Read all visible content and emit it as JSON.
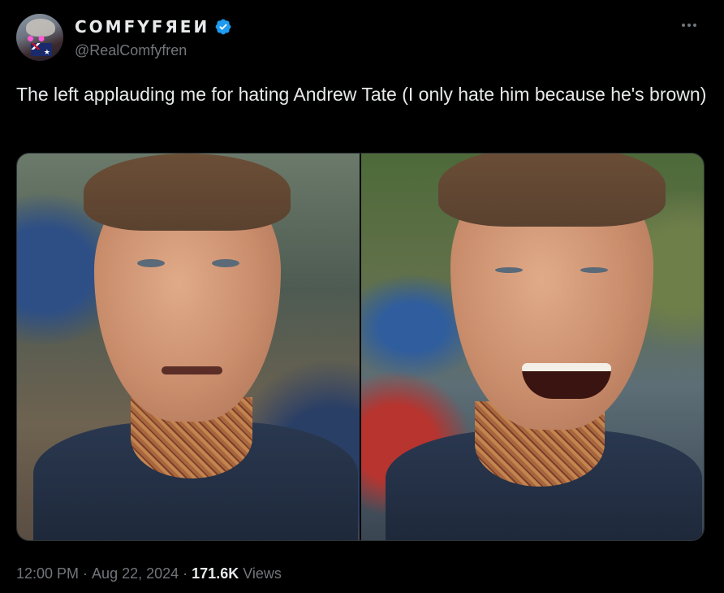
{
  "author": {
    "display_name": "COMFYFЯEИ",
    "handle": "@RealComfyfren",
    "verified": true,
    "avatar_icon": "avatar-image"
  },
  "tweet": {
    "text": "The left applauding me for hating Andrew Tate (I only hate him because he's brown)"
  },
  "media": {
    "count": 2,
    "left_image_icon": "man-neutral-expression-image",
    "right_image_icon": "man-smiling-image"
  },
  "meta": {
    "time": "12:00 PM",
    "separator1": " · ",
    "date": "Aug 22, 2024",
    "separator2": " · ",
    "views_count": "171.6K",
    "views_label": " Views"
  },
  "colors": {
    "background": "#000000",
    "text_primary": "#e7e9ea",
    "text_secondary": "#71767b",
    "verified_blue": "#1d9bf0",
    "border": "#2f3336"
  }
}
